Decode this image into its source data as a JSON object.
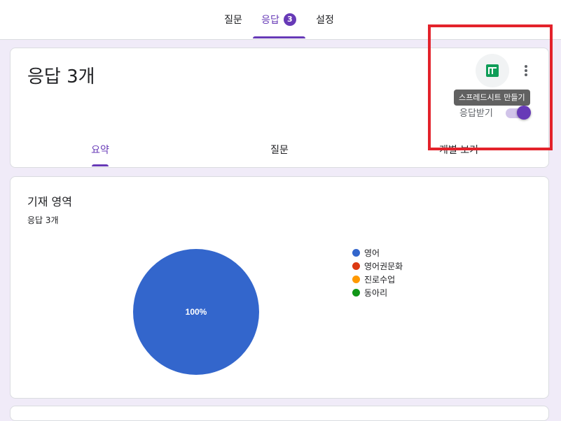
{
  "nav": {
    "tabs": [
      {
        "label": "질문"
      },
      {
        "label": "응답",
        "badge": "3"
      },
      {
        "label": "설정"
      }
    ],
    "active_tab": "응답"
  },
  "summary": {
    "title": "응답 3개",
    "tooltip": "스프레드시트 만들기",
    "accept_label": "응답받기",
    "accept_enabled": true,
    "subtabs": [
      {
        "label": "요약"
      },
      {
        "label": "질문"
      },
      {
        "label": "개별 보기"
      }
    ],
    "active_subtab": "요약"
  },
  "question": {
    "title": "기재 영역",
    "count": "응답 3개",
    "chart_data": {
      "type": "pie",
      "categories": [
        "영어",
        "영어권문화",
        "진로수업",
        "동아리"
      ],
      "values": [
        3,
        0,
        0,
        0
      ],
      "colors": [
        "#3366cc",
        "#dc3912",
        "#ff9900",
        "#109618"
      ],
      "data_labels": [
        "100%"
      ],
      "legend_position": "right"
    }
  },
  "icons": {
    "sheets": "sheets-icon",
    "more": "more-vert-icon"
  },
  "colors": {
    "accent": "#673ab7",
    "background": "#f0ebf8",
    "highlight": "#e3222b",
    "sheets_green": "#0f9d58"
  }
}
